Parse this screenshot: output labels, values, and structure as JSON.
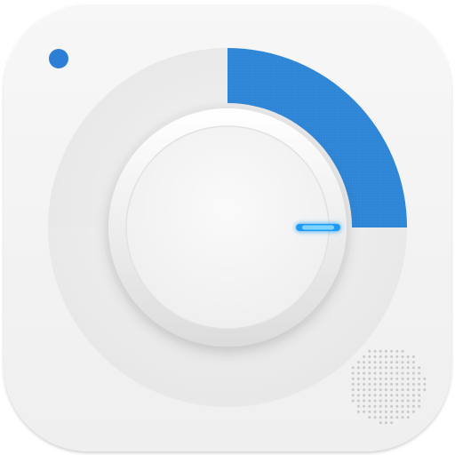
{
  "icon": {
    "name": "timer-app-icon",
    "accent_color": "#2f86d6",
    "accent_dark": "#2a7cc8",
    "led_color": "#27a9ff",
    "status_dot_color": "#2d7fd6",
    "background_color": "#f2f2f2"
  },
  "dial": {
    "progress_fraction": 0.25
  }
}
